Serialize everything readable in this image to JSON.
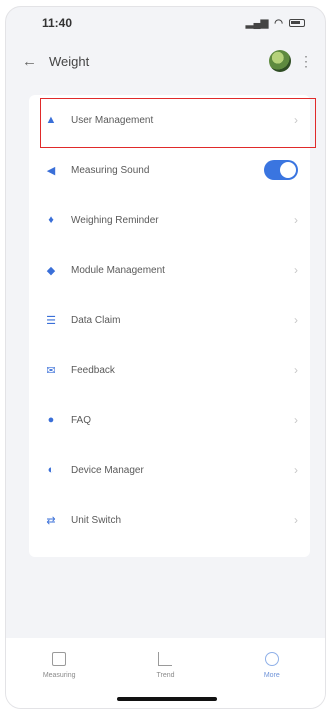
{
  "status_bar": {
    "time": "11:40"
  },
  "header": {
    "back_icon": "arrow-left",
    "title": "Weight"
  },
  "menu": {
    "items": [
      {
        "label": "User Management",
        "icon": "person"
      },
      {
        "label": "Measuring Sound",
        "icon": "speaker",
        "toggle_on": true
      },
      {
        "label": "Weighing Reminder",
        "icon": "bell"
      },
      {
        "label": "Module Management",
        "icon": "module"
      },
      {
        "label": "Data Claim",
        "icon": "list"
      },
      {
        "label": "Feedback",
        "icon": "message"
      },
      {
        "label": "FAQ",
        "icon": "question"
      },
      {
        "label": "Device Manager",
        "icon": "device"
      },
      {
        "label": "Unit Switch",
        "icon": "switch"
      }
    ]
  },
  "tabbar": {
    "tabs": [
      {
        "label": "Measuring"
      },
      {
        "label": "Trend"
      },
      {
        "label": "More"
      }
    ]
  },
  "colors": {
    "accent": "#3a75e0",
    "highlight_border": "#e02a2a",
    "background": "#f3f4f7"
  }
}
